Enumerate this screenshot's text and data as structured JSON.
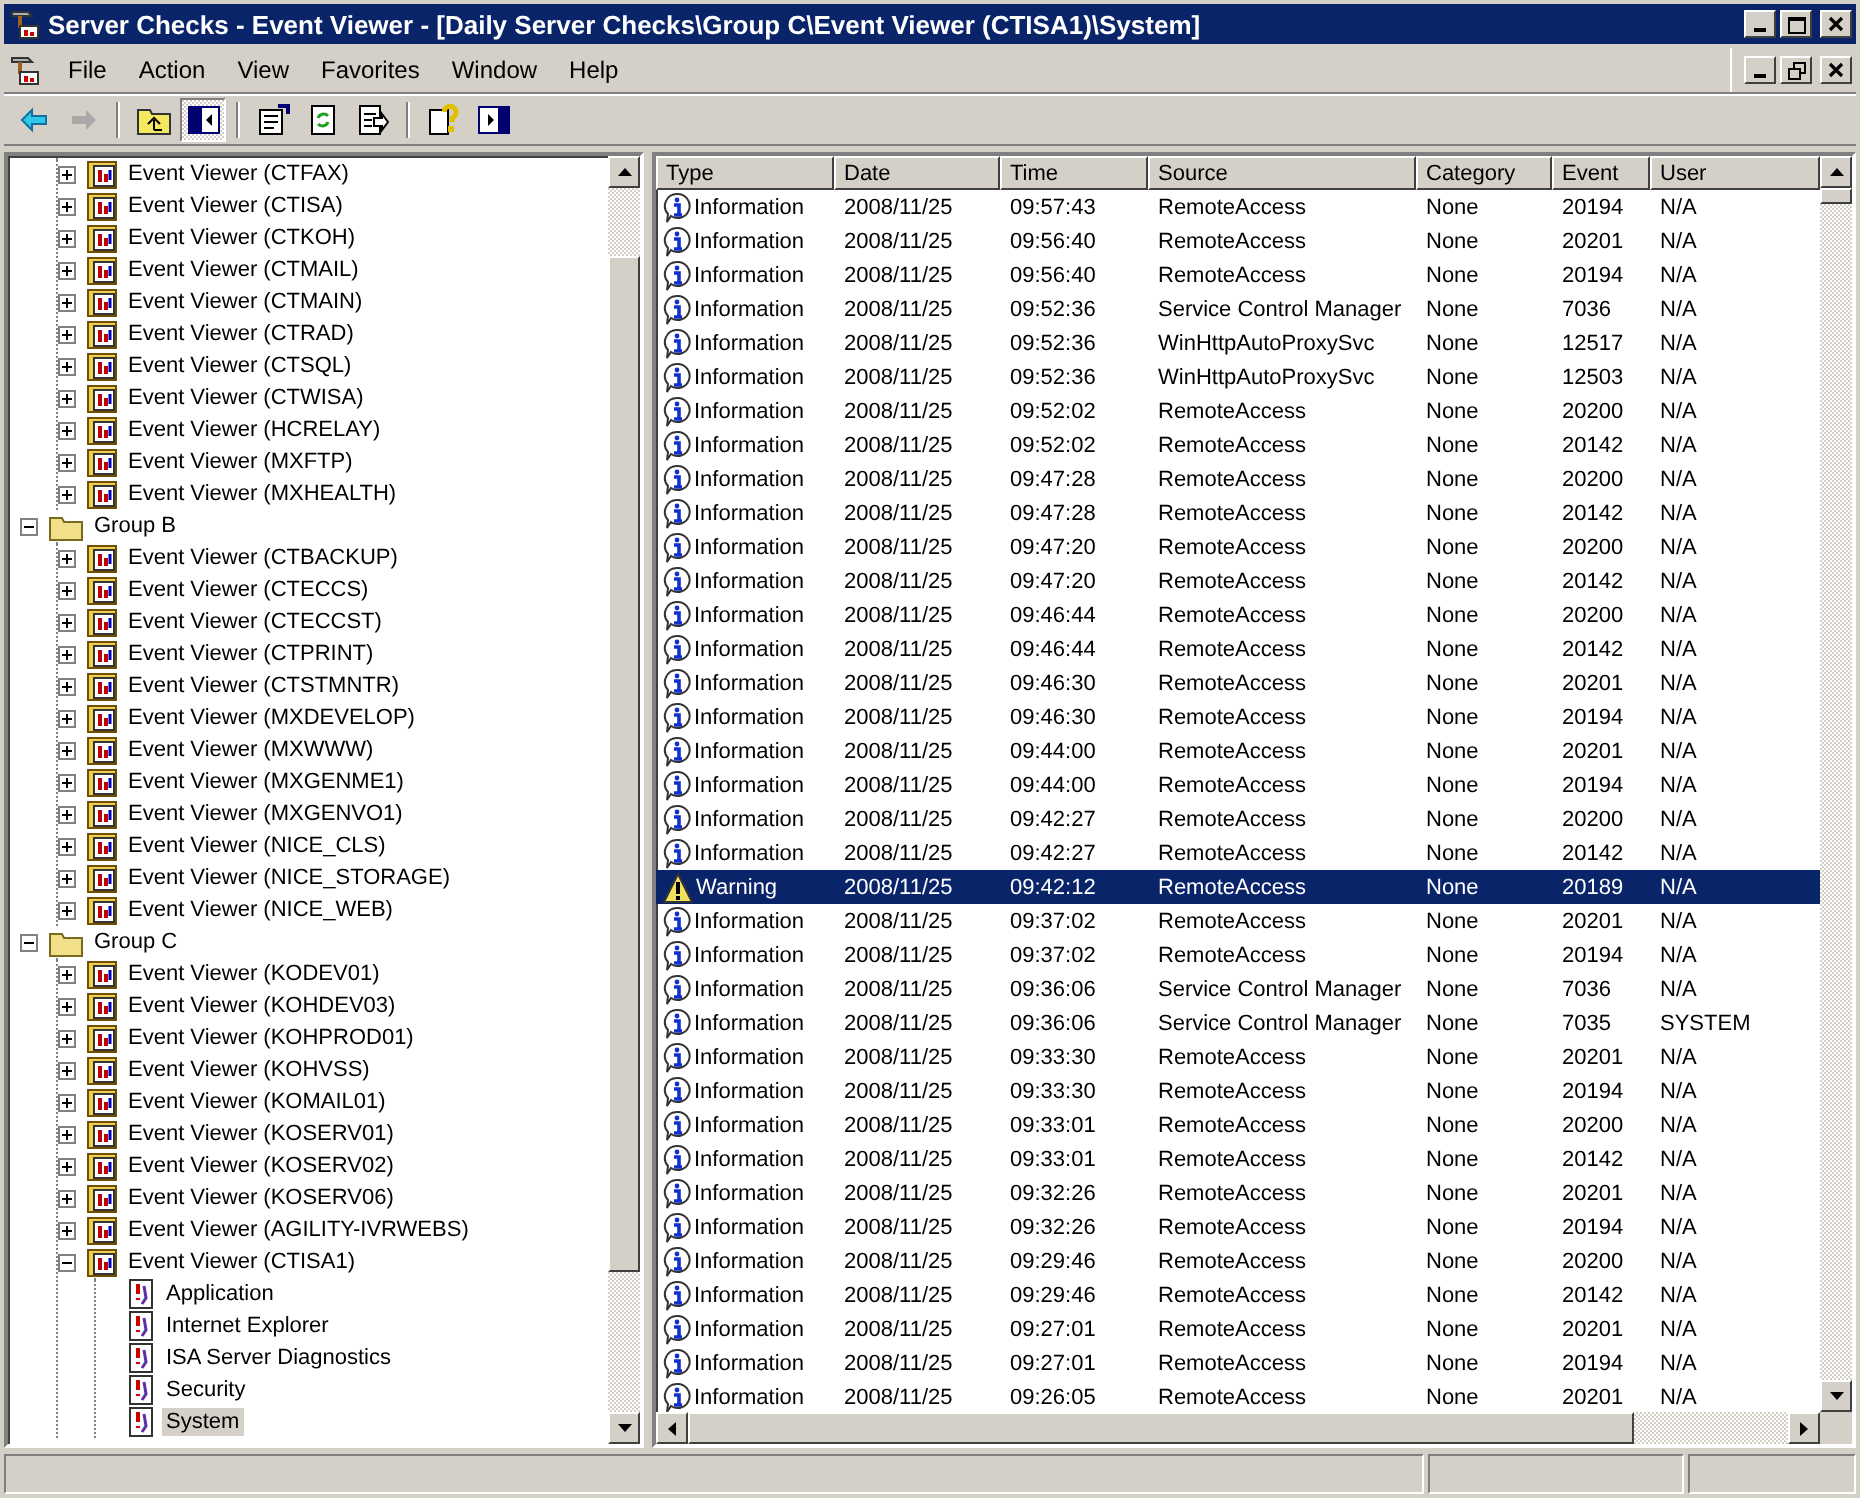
{
  "window": {
    "title": "Server Checks - Event Viewer - [Daily Server Checks\\Group C\\Event Viewer (CTISA1)\\System]"
  },
  "menu": [
    "File",
    "Action",
    "View",
    "Favorites",
    "Window",
    "Help"
  ],
  "toolbar": [
    {
      "kind": "back",
      "disabled": false,
      "pressed": false
    },
    {
      "kind": "forward",
      "disabled": true,
      "pressed": false
    },
    {
      "kind": "up",
      "disabled": false,
      "pressed": false
    },
    {
      "kind": "tree",
      "disabled": false,
      "pressed": true
    },
    {
      "kind": "properties",
      "disabled": false,
      "pressed": false
    },
    {
      "kind": "refresh",
      "disabled": false,
      "pressed": false
    },
    {
      "kind": "export",
      "disabled": false,
      "pressed": false
    },
    {
      "kind": "help",
      "disabled": false,
      "pressed": false
    },
    {
      "kind": "pane",
      "disabled": false,
      "pressed": false
    }
  ],
  "tree": {
    "nodes": [
      {
        "children": [
          {
            "kind": "viewer",
            "label": "Event Viewer (CTFAX)",
            "expanded": false,
            "selected": false
          },
          {
            "kind": "viewer",
            "label": "Event Viewer (CTISA)",
            "expanded": false,
            "selected": false
          },
          {
            "kind": "viewer",
            "label": "Event Viewer (CTKOH)",
            "expanded": false,
            "selected": false
          },
          {
            "kind": "viewer",
            "label": "Event Viewer (CTMAIL)",
            "expanded": false,
            "selected": false
          },
          {
            "kind": "viewer",
            "label": "Event Viewer (CTMAIN)",
            "expanded": false,
            "selected": false
          },
          {
            "kind": "viewer",
            "label": "Event Viewer (CTRAD)",
            "expanded": false,
            "selected": false
          },
          {
            "kind": "viewer",
            "label": "Event Viewer (CTSQL)",
            "expanded": false,
            "selected": false
          },
          {
            "kind": "viewer",
            "label": "Event Viewer (CTWISA)",
            "expanded": false,
            "selected": false
          },
          {
            "kind": "viewer",
            "label": "Event Viewer (HCRELAY)",
            "expanded": false,
            "selected": false
          },
          {
            "kind": "viewer",
            "label": "Event Viewer (MXFTP)",
            "expanded": false,
            "selected": false
          },
          {
            "kind": "viewer",
            "label": "Event Viewer (MXHEALTH)",
            "expanded": false,
            "selected": false
          }
        ]
      },
      {
        "kind": "group",
        "label": "Group B",
        "expanded": true,
        "selected": false,
        "children": [
          {
            "kind": "viewer",
            "label": "Event Viewer (CTBACKUP)",
            "expanded": false,
            "selected": false
          },
          {
            "kind": "viewer",
            "label": "Event Viewer (CTECCS)",
            "expanded": false,
            "selected": false
          },
          {
            "kind": "viewer",
            "label": "Event Viewer (CTECCST)",
            "expanded": false,
            "selected": false
          },
          {
            "kind": "viewer",
            "label": "Event Viewer (CTPRINT)",
            "expanded": false,
            "selected": false
          },
          {
            "kind": "viewer",
            "label": "Event Viewer (CTSTMNTR)",
            "expanded": false,
            "selected": false
          },
          {
            "kind": "viewer",
            "label": "Event Viewer (MXDEVELOP)",
            "expanded": false,
            "selected": false
          },
          {
            "kind": "viewer",
            "label": "Event Viewer (MXWWW)",
            "expanded": false,
            "selected": false
          },
          {
            "kind": "viewer",
            "label": "Event Viewer (MXGENME1)",
            "expanded": false,
            "selected": false
          },
          {
            "kind": "viewer",
            "label": "Event Viewer (MXGENVO1)",
            "expanded": false,
            "selected": false
          },
          {
            "kind": "viewer",
            "label": "Event Viewer (NICE_CLS)",
            "expanded": false,
            "selected": false
          },
          {
            "kind": "viewer",
            "label": "Event Viewer (NICE_STORAGE)",
            "expanded": false,
            "selected": false
          },
          {
            "kind": "viewer",
            "label": "Event Viewer (NICE_WEB)",
            "expanded": false,
            "selected": false
          }
        ]
      },
      {
        "kind": "group",
        "label": "Group C",
        "expanded": true,
        "selected": false,
        "children": [
          {
            "kind": "viewer",
            "label": "Event Viewer (KODEV01)",
            "expanded": false,
            "selected": false
          },
          {
            "kind": "viewer",
            "label": "Event Viewer (KOHDEV03)",
            "expanded": false,
            "selected": false
          },
          {
            "kind": "viewer",
            "label": "Event Viewer (KOHPROD01)",
            "expanded": false,
            "selected": false
          },
          {
            "kind": "viewer",
            "label": "Event Viewer (KOHVSS)",
            "expanded": false,
            "selected": false
          },
          {
            "kind": "viewer",
            "label": "Event Viewer (KOMAIL01)",
            "expanded": false,
            "selected": false
          },
          {
            "kind": "viewer",
            "label": "Event Viewer (KOSERV01)",
            "expanded": false,
            "selected": false
          },
          {
            "kind": "viewer",
            "label": "Event Viewer (KOSERV02)",
            "expanded": false,
            "selected": false
          },
          {
            "kind": "viewer",
            "label": "Event Viewer (KOSERV06)",
            "expanded": false,
            "selected": false
          },
          {
            "kind": "viewer",
            "label": "Event Viewer (AGILITY-IVRWEBS)",
            "expanded": false,
            "selected": false
          },
          {
            "kind": "viewer",
            "label": "Event Viewer (CTISA1)",
            "expanded": true,
            "selected": false,
            "children": [
              {
                "kind": "log",
                "label": "Application",
                "selected": false
              },
              {
                "kind": "log",
                "label": "Internet Explorer",
                "selected": false
              },
              {
                "kind": "log",
                "label": "ISA Server Diagnostics",
                "selected": false
              },
              {
                "kind": "log",
                "label": "Security",
                "selected": false
              },
              {
                "kind": "log",
                "label": "System",
                "selected": true
              }
            ]
          }
        ]
      }
    ]
  },
  "table": {
    "columns": [
      "Type",
      "Date",
      "Time",
      "Source",
      "Category",
      "Event",
      "User"
    ],
    "rows": [
      {
        "kind": "information",
        "selected": false,
        "cells": [
          "Information",
          "2008/11/25",
          "09:57:43",
          "RemoteAccess",
          "None",
          "20194",
          "N/A"
        ]
      },
      {
        "kind": "information",
        "selected": false,
        "cells": [
          "Information",
          "2008/11/25",
          "09:56:40",
          "RemoteAccess",
          "None",
          "20201",
          "N/A"
        ]
      },
      {
        "kind": "information",
        "selected": false,
        "cells": [
          "Information",
          "2008/11/25",
          "09:56:40",
          "RemoteAccess",
          "None",
          "20194",
          "N/A"
        ]
      },
      {
        "kind": "information",
        "selected": false,
        "cells": [
          "Information",
          "2008/11/25",
          "09:52:36",
          "Service Control Manager",
          "None",
          "7036",
          "N/A"
        ]
      },
      {
        "kind": "information",
        "selected": false,
        "cells": [
          "Information",
          "2008/11/25",
          "09:52:36",
          "WinHttpAutoProxySvc",
          "None",
          "12517",
          "N/A"
        ]
      },
      {
        "kind": "information",
        "selected": false,
        "cells": [
          "Information",
          "2008/11/25",
          "09:52:36",
          "WinHttpAutoProxySvc",
          "None",
          "12503",
          "N/A"
        ]
      },
      {
        "kind": "information",
        "selected": false,
        "cells": [
          "Information",
          "2008/11/25",
          "09:52:02",
          "RemoteAccess",
          "None",
          "20200",
          "N/A"
        ]
      },
      {
        "kind": "information",
        "selected": false,
        "cells": [
          "Information",
          "2008/11/25",
          "09:52:02",
          "RemoteAccess",
          "None",
          "20142",
          "N/A"
        ]
      },
      {
        "kind": "information",
        "selected": false,
        "cells": [
          "Information",
          "2008/11/25",
          "09:47:28",
          "RemoteAccess",
          "None",
          "20200",
          "N/A"
        ]
      },
      {
        "kind": "information",
        "selected": false,
        "cells": [
          "Information",
          "2008/11/25",
          "09:47:28",
          "RemoteAccess",
          "None",
          "20142",
          "N/A"
        ]
      },
      {
        "kind": "information",
        "selected": false,
        "cells": [
          "Information",
          "2008/11/25",
          "09:47:20",
          "RemoteAccess",
          "None",
          "20200",
          "N/A"
        ]
      },
      {
        "kind": "information",
        "selected": false,
        "cells": [
          "Information",
          "2008/11/25",
          "09:47:20",
          "RemoteAccess",
          "None",
          "20142",
          "N/A"
        ]
      },
      {
        "kind": "information",
        "selected": false,
        "cells": [
          "Information",
          "2008/11/25",
          "09:46:44",
          "RemoteAccess",
          "None",
          "20200",
          "N/A"
        ]
      },
      {
        "kind": "information",
        "selected": false,
        "cells": [
          "Information",
          "2008/11/25",
          "09:46:44",
          "RemoteAccess",
          "None",
          "20142",
          "N/A"
        ]
      },
      {
        "kind": "information",
        "selected": false,
        "cells": [
          "Information",
          "2008/11/25",
          "09:46:30",
          "RemoteAccess",
          "None",
          "20201",
          "N/A"
        ]
      },
      {
        "kind": "information",
        "selected": false,
        "cells": [
          "Information",
          "2008/11/25",
          "09:46:30",
          "RemoteAccess",
          "None",
          "20194",
          "N/A"
        ]
      },
      {
        "kind": "information",
        "selected": false,
        "cells": [
          "Information",
          "2008/11/25",
          "09:44:00",
          "RemoteAccess",
          "None",
          "20201",
          "N/A"
        ]
      },
      {
        "kind": "information",
        "selected": false,
        "cells": [
          "Information",
          "2008/11/25",
          "09:44:00",
          "RemoteAccess",
          "None",
          "20194",
          "N/A"
        ]
      },
      {
        "kind": "information",
        "selected": false,
        "cells": [
          "Information",
          "2008/11/25",
          "09:42:27",
          "RemoteAccess",
          "None",
          "20200",
          "N/A"
        ]
      },
      {
        "kind": "information",
        "selected": false,
        "cells": [
          "Information",
          "2008/11/25",
          "09:42:27",
          "RemoteAccess",
          "None",
          "20142",
          "N/A"
        ]
      },
      {
        "kind": "warning",
        "selected": true,
        "cells": [
          "Warning",
          "2008/11/25",
          "09:42:12",
          "RemoteAccess",
          "None",
          "20189",
          "N/A"
        ]
      },
      {
        "kind": "information",
        "selected": false,
        "cells": [
          "Information",
          "2008/11/25",
          "09:37:02",
          "RemoteAccess",
          "None",
          "20201",
          "N/A"
        ]
      },
      {
        "kind": "information",
        "selected": false,
        "cells": [
          "Information",
          "2008/11/25",
          "09:37:02",
          "RemoteAccess",
          "None",
          "20194",
          "N/A"
        ]
      },
      {
        "kind": "information",
        "selected": false,
        "cells": [
          "Information",
          "2008/11/25",
          "09:36:06",
          "Service Control Manager",
          "None",
          "7036",
          "N/A"
        ]
      },
      {
        "kind": "information",
        "selected": false,
        "cells": [
          "Information",
          "2008/11/25",
          "09:36:06",
          "Service Control Manager",
          "None",
          "7035",
          "SYSTEM"
        ]
      },
      {
        "kind": "information",
        "selected": false,
        "cells": [
          "Information",
          "2008/11/25",
          "09:33:30",
          "RemoteAccess",
          "None",
          "20201",
          "N/A"
        ]
      },
      {
        "kind": "information",
        "selected": false,
        "cells": [
          "Information",
          "2008/11/25",
          "09:33:30",
          "RemoteAccess",
          "None",
          "20194",
          "N/A"
        ]
      },
      {
        "kind": "information",
        "selected": false,
        "cells": [
          "Information",
          "2008/11/25",
          "09:33:01",
          "RemoteAccess",
          "None",
          "20200",
          "N/A"
        ]
      },
      {
        "kind": "information",
        "selected": false,
        "cells": [
          "Information",
          "2008/11/25",
          "09:33:01",
          "RemoteAccess",
          "None",
          "20142",
          "N/A"
        ]
      },
      {
        "kind": "information",
        "selected": false,
        "cells": [
          "Information",
          "2008/11/25",
          "09:32:26",
          "RemoteAccess",
          "None",
          "20201",
          "N/A"
        ]
      },
      {
        "kind": "information",
        "selected": false,
        "cells": [
          "Information",
          "2008/11/25",
          "09:32:26",
          "RemoteAccess",
          "None",
          "20194",
          "N/A"
        ]
      },
      {
        "kind": "information",
        "selected": false,
        "cells": [
          "Information",
          "2008/11/25",
          "09:29:46",
          "RemoteAccess",
          "None",
          "20200",
          "N/A"
        ]
      },
      {
        "kind": "information",
        "selected": false,
        "cells": [
          "Information",
          "2008/11/25",
          "09:29:46",
          "RemoteAccess",
          "None",
          "20142",
          "N/A"
        ]
      },
      {
        "kind": "information",
        "selected": false,
        "cells": [
          "Information",
          "2008/11/25",
          "09:27:01",
          "RemoteAccess",
          "None",
          "20201",
          "N/A"
        ]
      },
      {
        "kind": "information",
        "selected": false,
        "cells": [
          "Information",
          "2008/11/25",
          "09:27:01",
          "RemoteAccess",
          "None",
          "20194",
          "N/A"
        ]
      },
      {
        "kind": "information",
        "selected": false,
        "cells": [
          "Information",
          "2008/11/25",
          "09:26:05",
          "RemoteAccess",
          "None",
          "20201",
          "N/A"
        ]
      }
    ]
  }
}
